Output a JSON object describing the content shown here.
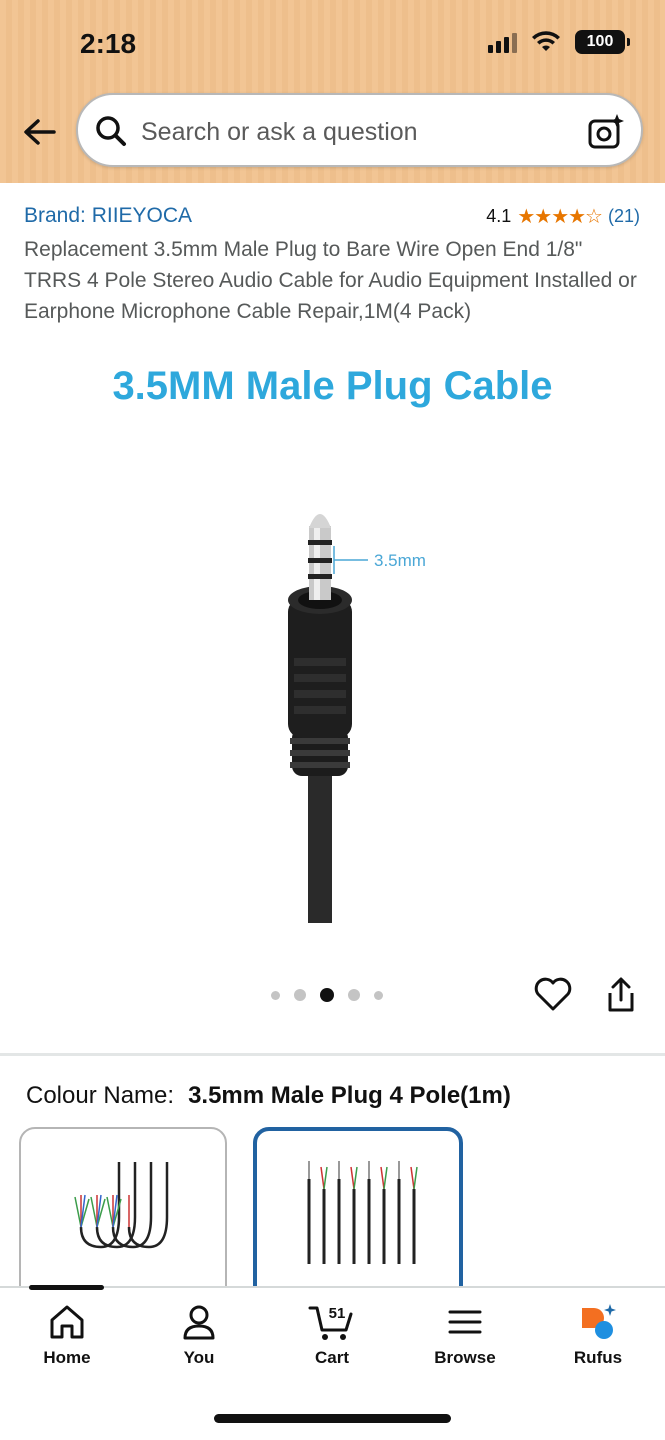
{
  "status_bar": {
    "time": "2:18",
    "battery": "100"
  },
  "search": {
    "placeholder": "Search or ask a question"
  },
  "product": {
    "brand": "Brand: RIIEYOCA",
    "rating": "4.1",
    "stars": "★★★★☆",
    "review_count": "(21)",
    "title": "Replacement 3.5mm Male Plug to Bare Wire Open End 1/8\" TRRS 4 Pole Stereo Audio Cable for Audio Equipment Installed or Earphone Microphone Cable Repair,1M(4 Pack)",
    "hero_heading": "3.5MM Male Plug Cable",
    "image_annotation": "3.5mm",
    "carousel": {
      "total": 5,
      "active_index": 2
    }
  },
  "variants": {
    "label": "Colour Name:",
    "selected": "3.5mm Male Plug 4 Pole(1m)"
  },
  "bottom_nav": {
    "items": [
      {
        "label": "Home",
        "icon": "home-icon"
      },
      {
        "label": "You",
        "icon": "person-icon"
      },
      {
        "label": "Cart",
        "icon": "cart-icon",
        "badge": "51"
      },
      {
        "label": "Browse",
        "icon": "menu-icon"
      },
      {
        "label": "Rufus",
        "icon": "rufus-icon"
      }
    ]
  },
  "colors": {
    "accent_blue": "#2ea8dc",
    "link": "#1f6aa8",
    "star": "#e77600",
    "selected_border": "#2162a1"
  }
}
